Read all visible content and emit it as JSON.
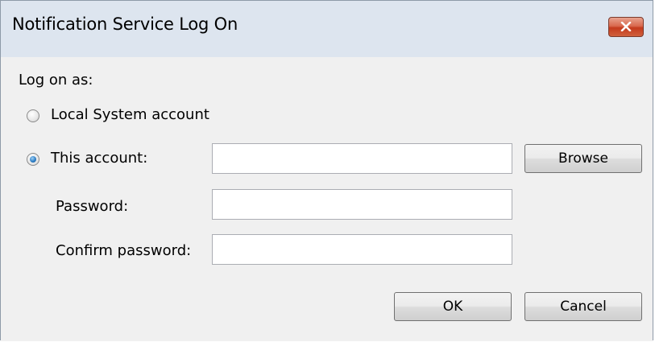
{
  "window": {
    "title": "Notification Service Log On",
    "close_icon": "close-icon"
  },
  "form": {
    "log_on_as_label": "Log on as:",
    "local_system_label": "Local System account",
    "local_system_selected": false,
    "this_account_label": "This account:",
    "this_account_selected": true,
    "account_value": "",
    "password_label": "Password:",
    "password_value": "",
    "confirm_password_label": "Confirm password:",
    "confirm_password_value": ""
  },
  "buttons": {
    "browse_label": "Browse",
    "ok_label": "OK",
    "cancel_label": "Cancel"
  },
  "colors": {
    "title_bar": "#dde5ef",
    "close_button": "#c43b1d",
    "dialog_background": "#f0f0f0"
  }
}
